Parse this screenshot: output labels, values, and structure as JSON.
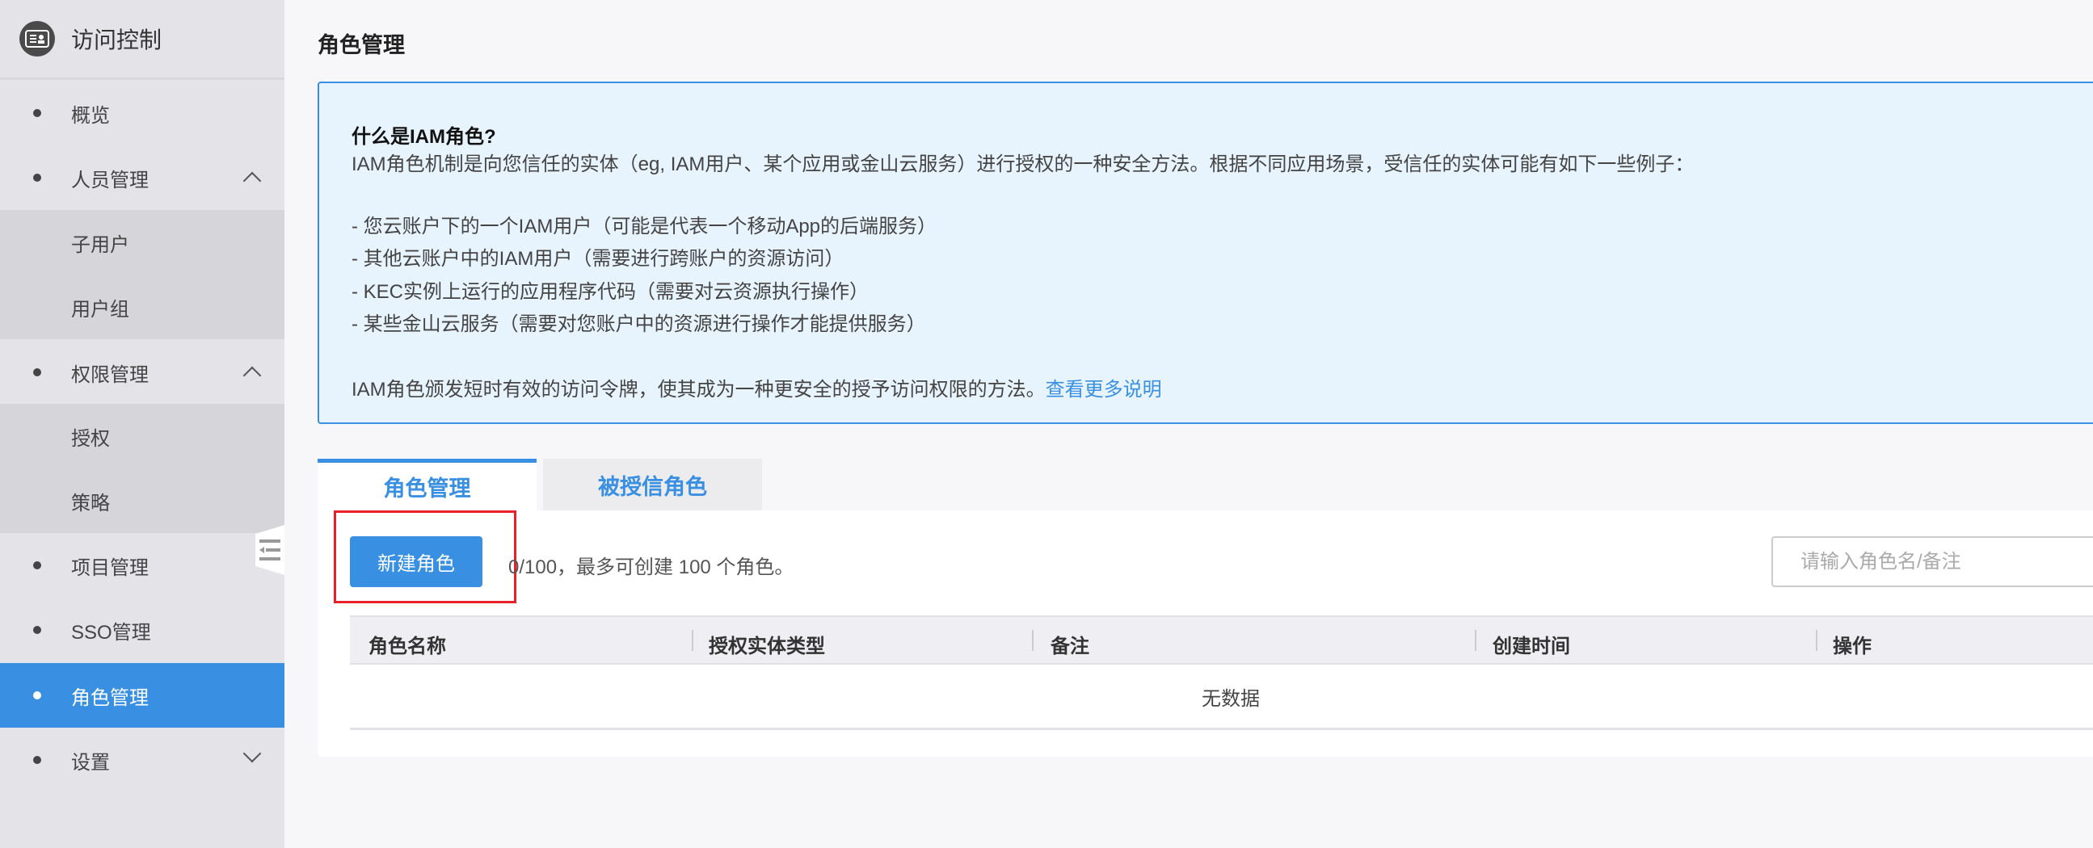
{
  "sidebar": {
    "title": "访问控制",
    "items": [
      {
        "label": "概览"
      },
      {
        "label": "人员管理"
      },
      {
        "label": "子用户"
      },
      {
        "label": "用户组"
      },
      {
        "label": "权限管理"
      },
      {
        "label": "授权"
      },
      {
        "label": "策略"
      },
      {
        "label": "项目管理"
      },
      {
        "label": "SSO管理"
      },
      {
        "label": "角色管理"
      },
      {
        "label": "设置"
      }
    ]
  },
  "page": {
    "title": "角色管理"
  },
  "info": {
    "heading": "什么是IAM角色?",
    "intro": "IAM角色机制是向您信任的实体（eg, IAM用户、某个应用或金山云服务）进行授权的一种安全方法。根据不同应用场景，受信任的实体可能有如下一些例子：",
    "examples": [
      "- 您云账户下的一个IAM用户（可能是代表一个移动App的后端服务）",
      "- 其他云账户中的IAM用户（需要进行跨账户的资源访问）",
      "- KEC实例上运行的应用程序代码（需要对云资源执行操作）",
      "- 某些金山云服务（需要对您账户中的资源进行操作才能提供服务）"
    ],
    "footer": "IAM角色颁发短时有效的访问令牌，使其成为一种更安全的授予访问权限的方法。",
    "link": "查看更多说明"
  },
  "tabs": [
    {
      "label": "角色管理"
    },
    {
      "label": "被授信角色"
    }
  ],
  "toolbar": {
    "create_label": "新建角色",
    "count_text": "0/100，最多可创建 100 个角色。",
    "search_placeholder": "请输入角色名/备注"
  },
  "table": {
    "columns": [
      "角色名称",
      "授权实体类型",
      "备注",
      "创建时间",
      "操作"
    ],
    "empty_text": "无数据"
  },
  "colors": {
    "accent": "#3990e2",
    "highlight": "#e8202a"
  }
}
